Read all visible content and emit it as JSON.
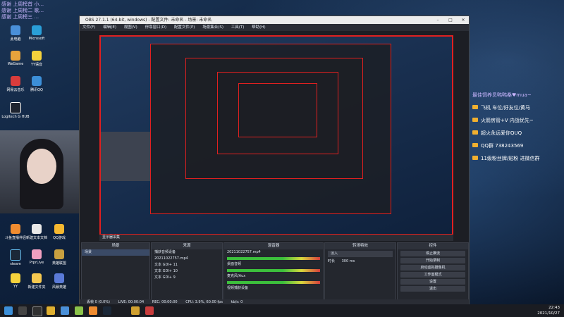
{
  "colors": {
    "accent": "#e02020",
    "overlay_text": "#c9b6ff",
    "meter_green": "#3cbf3c"
  },
  "stream": {
    "top_lines": [
      "感谢 上周榜首 小...",
      "感谢 上周榜二 歌...",
      "感谢 上周榜三 ..."
    ]
  },
  "desktop": {
    "icons": [
      {
        "label": "此电脑",
        "icon": "computer-icon"
      },
      {
        "label": "Microsoft",
        "icon": "edge-icon"
      },
      {
        "label": "WeGame",
        "icon": "wegame-icon"
      },
      {
        "label": "YY语音",
        "icon": "yy-icon"
      },
      {
        "label": "网易云音乐",
        "icon": "music-icon"
      },
      {
        "label": "腾讯QQ",
        "icon": "qq-icon"
      },
      {
        "label": "Logitech G HUB",
        "icon": "logitech-icon"
      },
      {
        "label": "斗鱼直播伴侣",
        "icon": "douyu-icon"
      },
      {
        "label": "新建文本文档",
        "icon": "text-file-icon"
      },
      {
        "label": "QQ游戏",
        "icon": "qqgame-icon"
      },
      {
        "label": "steam",
        "icon": "steam-icon"
      },
      {
        "label": "PrprLive",
        "icon": "prpr-icon"
      },
      {
        "label": "英雄联盟",
        "icon": "lol-icon"
      },
      {
        "label": "YY",
        "icon": "yy2-icon"
      },
      {
        "label": "新建文件夹",
        "icon": "folder-icon"
      },
      {
        "label": "风暴英雄",
        "icon": "hots-icon"
      }
    ]
  },
  "overlay": {
    "title": "最佳饲养员鸭鸭桑♥mua~",
    "lines": [
      "飞机 车位/好友位/黄马",
      "火箭房管+V 内战优先~",
      "超火永远爱你QUQ",
      "QQ群 738243569",
      "11级粉丝牌/贴粉 进微信群"
    ]
  },
  "obs": {
    "title": "OBS 27.1.1 (64-bit, windows) - 配置文件: 未命名 - 场景: 未命名",
    "menu": [
      "文件(F)",
      "编辑(E)",
      "视图(V)",
      "停靠窗口(D)",
      "配置文件(P)",
      "场景集合(S)",
      "工具(T)",
      "帮助(H)"
    ],
    "status_top": "显示器采集",
    "docks": {
      "scenes": {
        "header": "场景",
        "items": [
          "场景"
        ]
      },
      "sources": {
        "header": "来源",
        "items": [
          "捕获音频设备",
          "20211022757.mp4",
          "文本 GDI+ 11",
          "文本 GDI+ 10",
          "文本 GDI+ 9"
        ]
      },
      "mixer": {
        "header": "混音器",
        "items": [
          "20211022757.mp4",
          "桌面音频",
          "麦克风/Aux",
          "视频捕获设备"
        ]
      },
      "transitions": {
        "header": "转场特效",
        "fade": "淡入",
        "duration_label": "时长",
        "duration": "300 ms"
      },
      "controls": {
        "header": "控件",
        "buttons": [
          "停止推流",
          "开始录制",
          "启动虚拟摄像机",
          "工作室模式",
          "设置",
          "退出"
        ]
      }
    },
    "status": [
      "丢帧 0 (0.0%)",
      "LIVE: 00:00:04",
      "REC: 00:00:00",
      "CPU: 3.9%, 60.00 fps",
      "kb/s: 0"
    ]
  },
  "taskbar": {
    "time": "22:43",
    "date": "2021/10/27"
  }
}
